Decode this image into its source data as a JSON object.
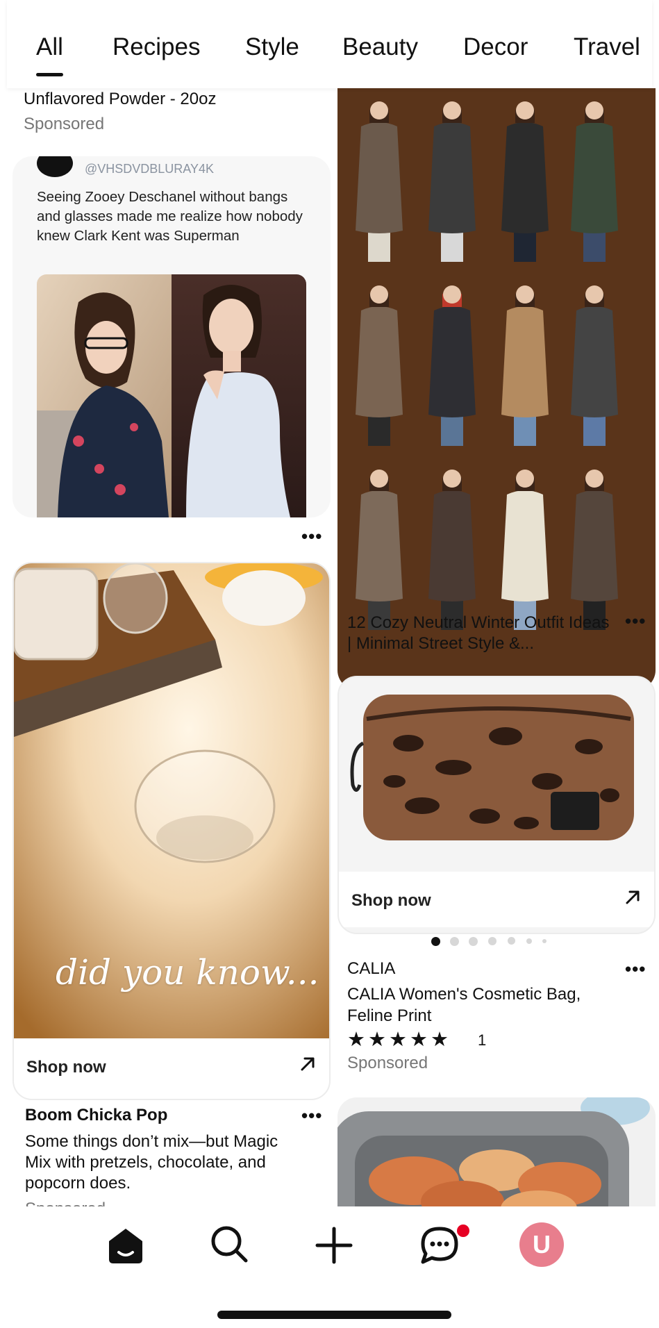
{
  "tabs": [
    {
      "label": "All",
      "active": true
    },
    {
      "label": "Recipes"
    },
    {
      "label": "Style"
    },
    {
      "label": "Beauty"
    },
    {
      "label": "Decor"
    },
    {
      "label": "Travel"
    }
  ],
  "left": {
    "top_pin": {
      "title": "Unflavored Powder - 20oz",
      "sponsored": "Sponsored"
    },
    "tweet_pin": {
      "handle": "@VHSDVDBLURAY4K",
      "text": "Seeing Zooey Deschanel without bangs and glasses made me realize how nobody knew Clark Kent was Superman",
      "menu": "•••"
    },
    "candle_pin": {
      "overlay": "did you know...",
      "shop_label": "Shop now",
      "brand": "Boom Chicka Pop",
      "description": "Some things don’t mix—but Magic Mix with pretzels, chocolate, and popcorn does.",
      "sponsored": "Sponsored",
      "menu": "•••"
    }
  },
  "right": {
    "outfit_pin": {
      "title": "12 Cozy Neutral Winter Outfit Ideas | Minimal Street Style &...",
      "menu": "•••"
    },
    "bag_pin": {
      "shop_label": "Shop now",
      "brand": "CALIA",
      "title": "CALIA Women's Cosmetic Bag, Feline Print",
      "stars": "★★★★★",
      "rating": 5,
      "review_count": "1",
      "sponsored": "Sponsored",
      "menu": "•••"
    }
  },
  "bottom_nav": {
    "items": [
      "home-icon",
      "search-icon",
      "plus-icon",
      "messages-icon",
      "profile-avatar"
    ],
    "avatar_letter": "U",
    "badge_color": "#e60023",
    "avatar_color": "#e87e8d"
  }
}
